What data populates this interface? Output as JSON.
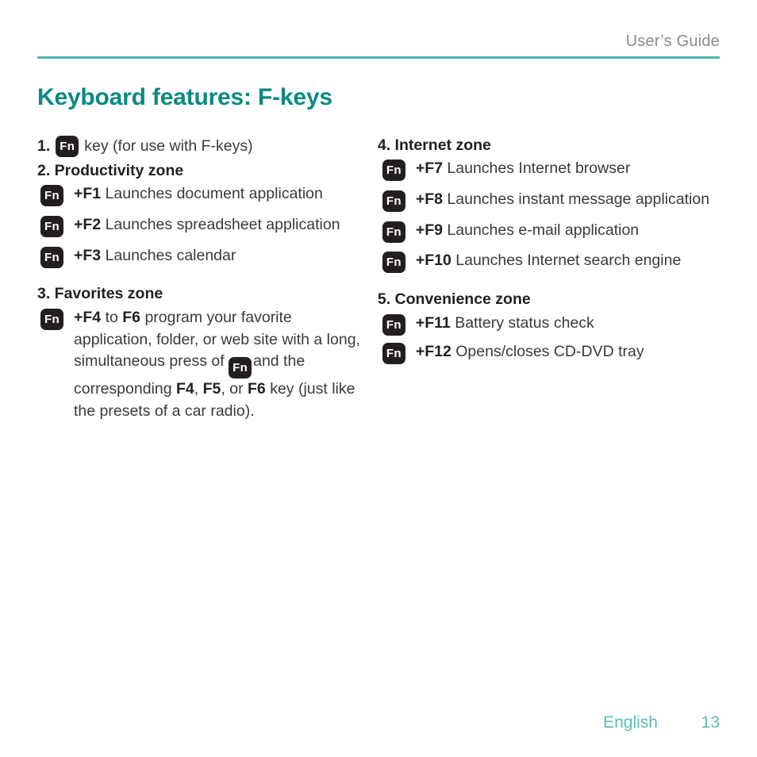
{
  "header": {
    "title": "User’s Guide",
    "rule_color": "#54b5ab"
  },
  "title": "Keyboard features: F-keys",
  "theme": {
    "title_color": "#0a8a83",
    "rule_color": "#54b5ab",
    "footer_color": "#5bbdb2",
    "badge_bg": "#231f20",
    "badge_fg": "#ffffff",
    "body_color": "#3a3a3a",
    "heading_color": "#231f20",
    "header_color": "#8a8a8a"
  },
  "badge": {
    "label": "Fn"
  },
  "left_column": {
    "item1": {
      "number": "1.",
      "badge": "Fn",
      "text": "key (for use with F-keys)"
    },
    "item2_heading": "2. Productivity zone",
    "productivity": [
      {
        "badge": "Fn",
        "key": "+F1",
        "desc": "Launches document application"
      },
      {
        "badge": "Fn",
        "key": "+F2",
        "desc": "Launches spreadsheet application"
      },
      {
        "badge": "Fn",
        "key": "+F3",
        "desc": "Launches calendar"
      }
    ],
    "item3_heading": "3. Favorites zone",
    "favorites": {
      "badge": "Fn",
      "key_start": "+F4",
      "word_to": "to",
      "key_end": "F6",
      "text_part1": "program your favorite application, folder, or web site with a long, simultaneous press of",
      "inline_badge": "Fn",
      "text_part2": "and the corresponding",
      "key_f4": "F4",
      "comma1": ",",
      "key_f5": "F5",
      "comma2": ",",
      "word_or": "or",
      "key_f6": "F6",
      "text_part3": "key (just like the presets of a car radio)."
    }
  },
  "right_column": {
    "item4_heading": "4. Internet zone",
    "internet": [
      {
        "badge": "Fn",
        "key": "+F7",
        "desc": "Launches Internet browser"
      },
      {
        "badge": "Fn",
        "key": "+F8",
        "desc": "Launches instant message application"
      },
      {
        "badge": "Fn",
        "key": "+F9",
        "desc": "Launches e-mail application"
      },
      {
        "badge": "Fn",
        "key": "+F10",
        "desc": "Launches Internet search engine"
      }
    ],
    "item5_heading": "5. Convenience zone",
    "convenience": [
      {
        "badge": "Fn",
        "key": "+F11",
        "desc": "Battery status check"
      },
      {
        "badge": "Fn",
        "key": "+F12",
        "desc": "Opens/closes CD-DVD tray"
      }
    ]
  },
  "footer": {
    "language": "English",
    "page_number": "13"
  }
}
